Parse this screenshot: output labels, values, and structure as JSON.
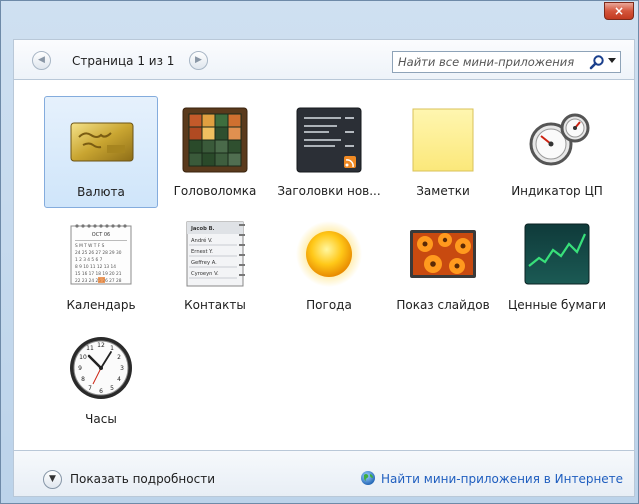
{
  "window": {
    "close_label": "×"
  },
  "toolbar": {
    "page_label": "Страница 1 из 1",
    "search_placeholder": "Найти все мини-приложения"
  },
  "gadgets": [
    {
      "label": "Валюта",
      "selected": true
    },
    {
      "label": "Головоломка"
    },
    {
      "label": "Заголовки нов..."
    },
    {
      "label": "Заметки"
    },
    {
      "label": "Индикатор ЦП"
    },
    {
      "label": "Календарь"
    },
    {
      "label": "Контакты"
    },
    {
      "label": "Погода"
    },
    {
      "label": "Показ слайдов"
    },
    {
      "label": "Ценные бумаги"
    },
    {
      "label": "Часы"
    }
  ],
  "thumb_text": {
    "calendar_month": "OCT 06",
    "contacts": [
      "Jacob B.",
      "André V.",
      "Ernest Y.",
      "Geffrey A.",
      "Cyroeyn V."
    ]
  },
  "footer": {
    "details_label": "Показать подробности",
    "online_link": "Найти мини-приложения в Интернете"
  },
  "colors": {
    "link": "#1f5ebf",
    "selection": "#cfe5fa",
    "close": "#c23a20"
  }
}
